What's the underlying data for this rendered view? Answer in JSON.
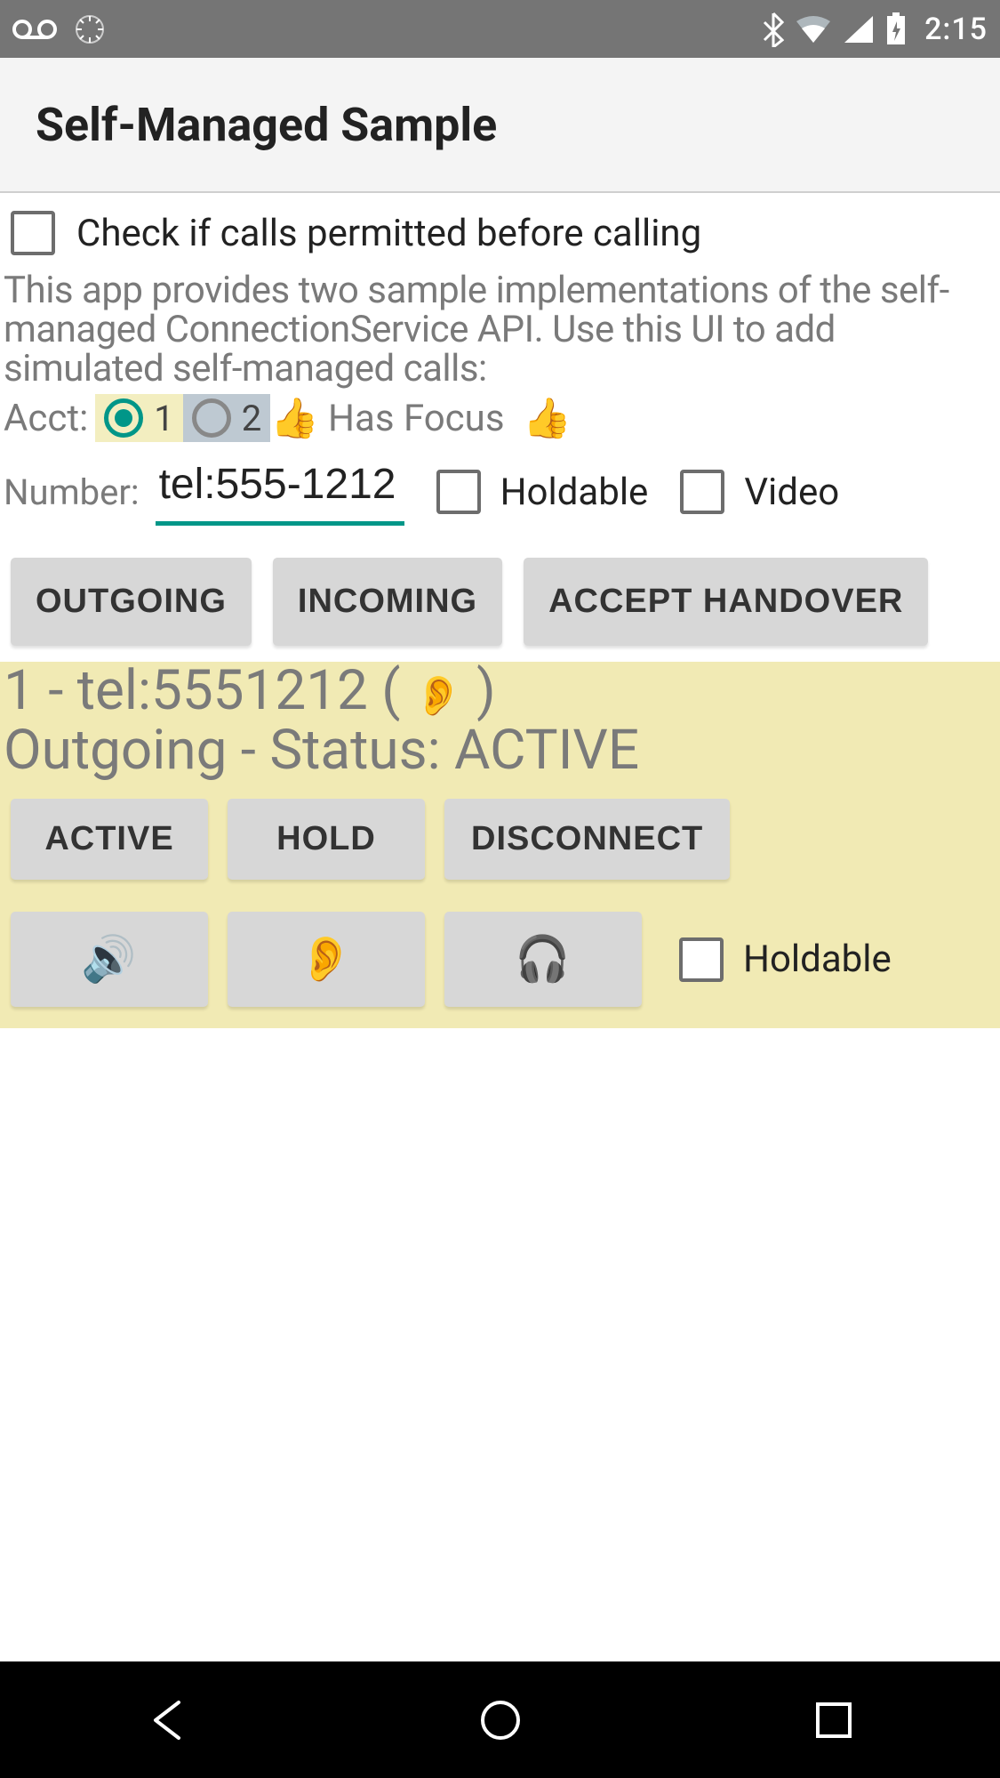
{
  "status": {
    "time": "2:15"
  },
  "app": {
    "title": "Self-Managed Sample"
  },
  "check_permitted": {
    "label": "Check if calls permitted before calling"
  },
  "description": "This app provides two sample implementations of the self-managed ConnectionService API.  Use this UI to add simulated self-managed calls:",
  "acct": {
    "label": "Acct:",
    "opt1": "1",
    "opt2": "2",
    "focus": "Has Focus",
    "thumb": "👍"
  },
  "number": {
    "label": "Number:",
    "value": "tel:555-1212",
    "holdable_label": "Holdable",
    "video_label": "Video"
  },
  "buttons": {
    "outgoing": "OUTGOING",
    "incoming": "INCOMING",
    "accept_handover": "ACCEPT HANDOVER"
  },
  "call": {
    "line1_a": "1 - tel:5551212 ( ",
    "line1_ear": "👂",
    "line1_b": " )",
    "line2": "Outgoing - Status: ACTIVE",
    "btn_active": "ACTIVE",
    "btn_hold": "HOLD",
    "btn_disconnect": "DISCONNECT",
    "btn_speaker": "🔊",
    "btn_ear": "👂",
    "btn_headphones": "🎧",
    "holdable_label": "Holdable"
  }
}
